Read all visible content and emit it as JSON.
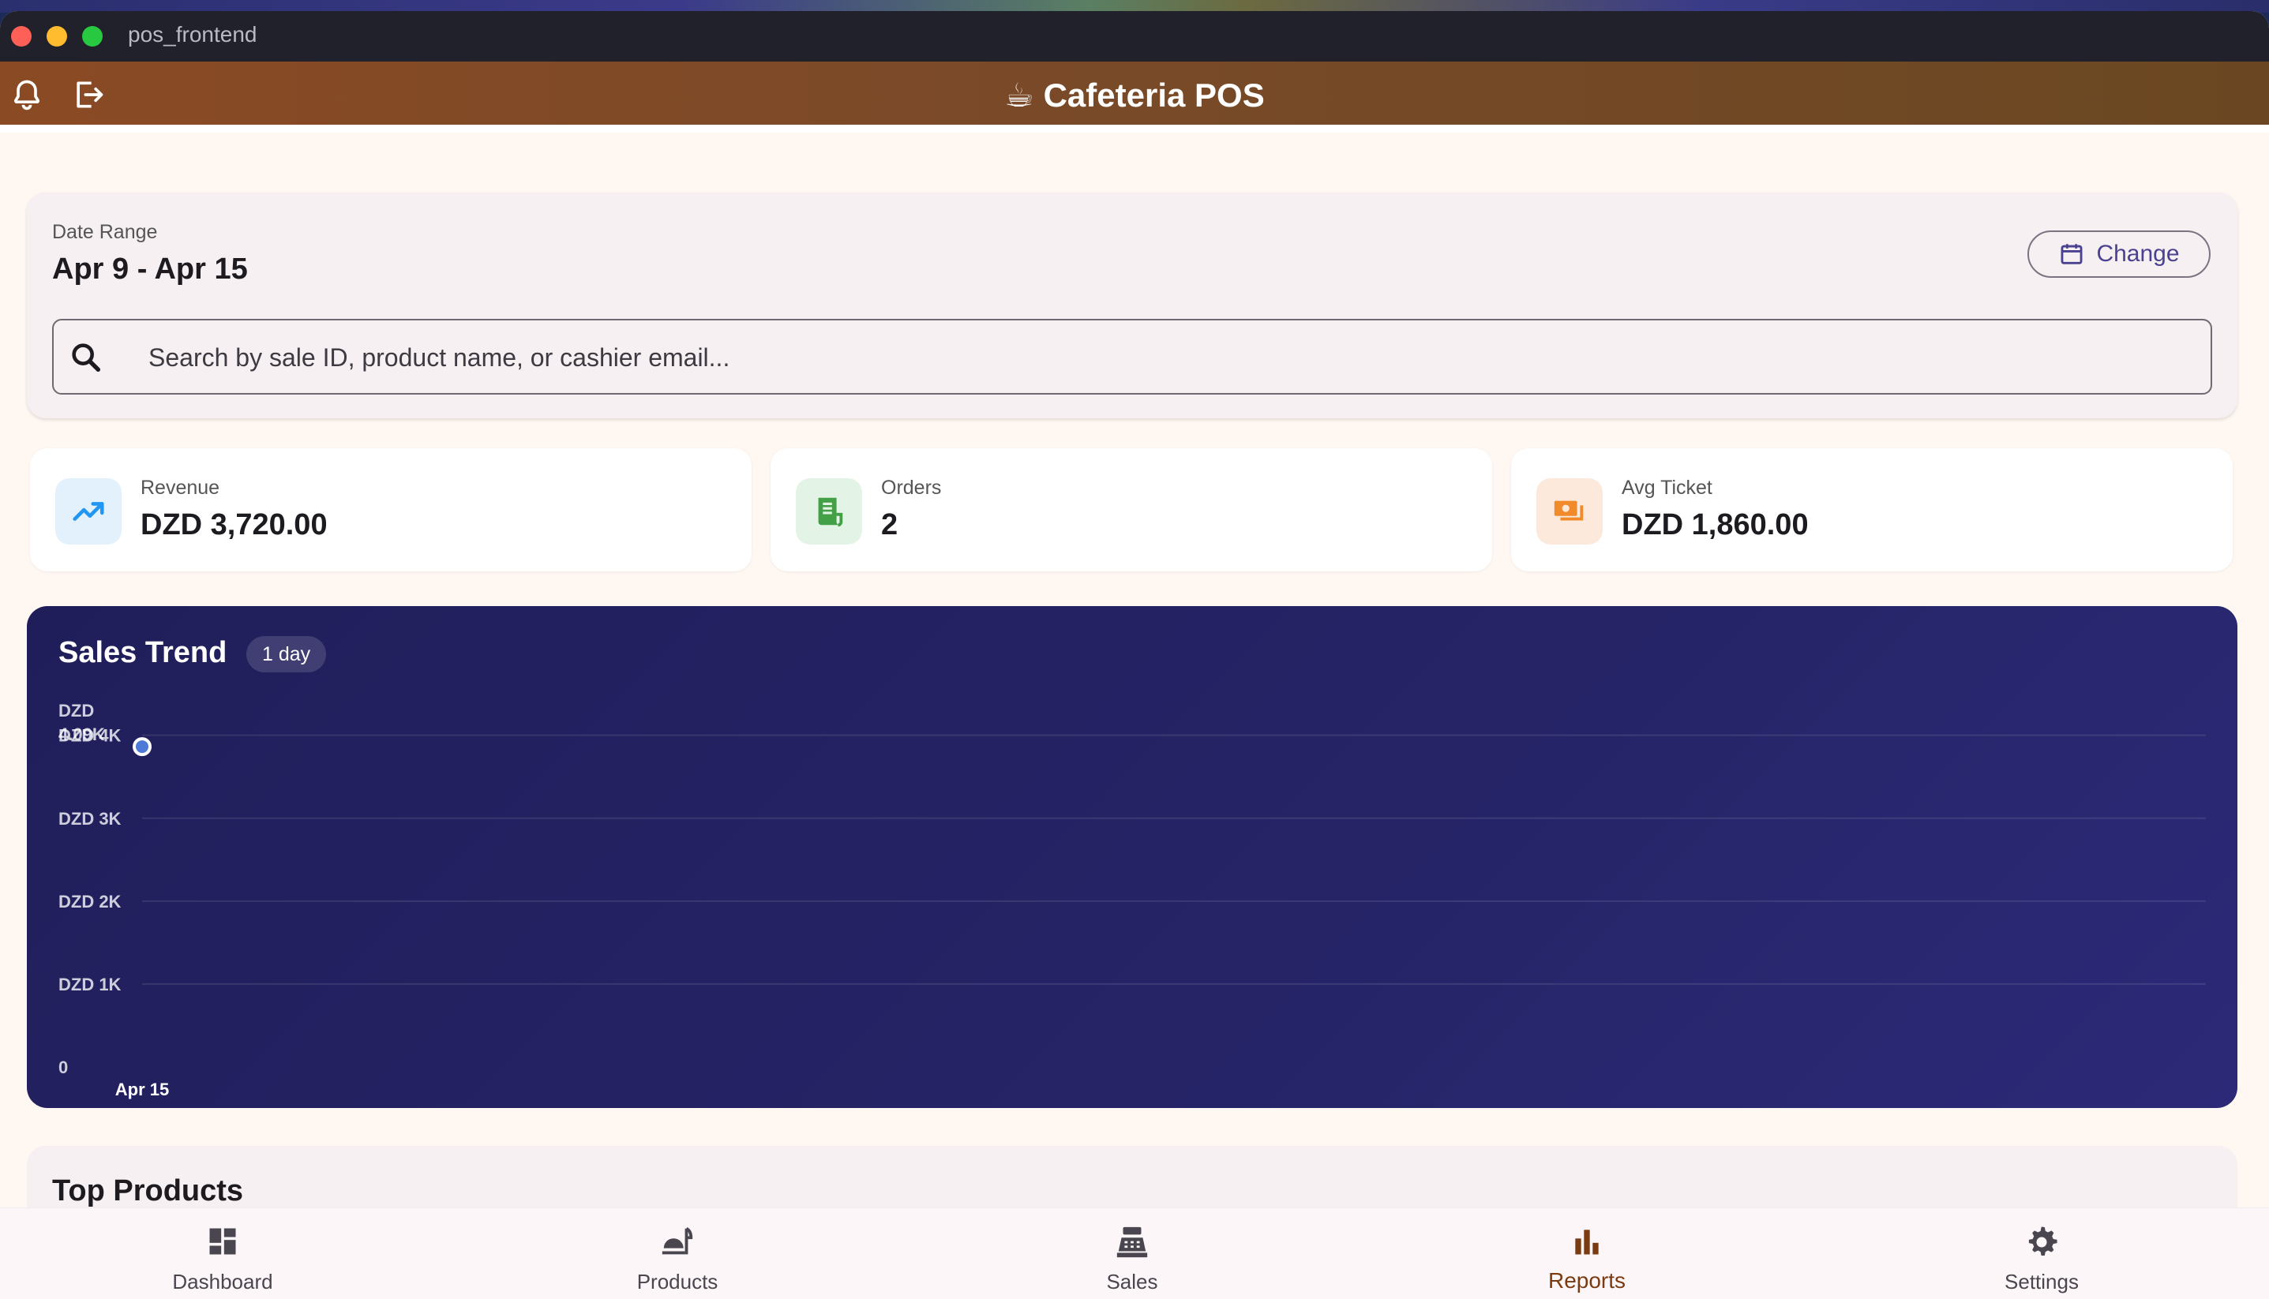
{
  "window": {
    "title": "pos_frontend"
  },
  "appbar": {
    "title": "☕ Cafeteria POS",
    "notifications_icon": "bell-icon",
    "logout_icon": "logout-icon"
  },
  "date_range": {
    "label": "Date Range",
    "value": "Apr 9 - Apr 15",
    "change_label": "Change"
  },
  "search": {
    "placeholder": "Search by sale ID, product name, or cashier email..."
  },
  "stats": [
    {
      "label": "Revenue",
      "value": "DZD 3,720.00",
      "icon": "trending-up-icon",
      "color": "#2196f3"
    },
    {
      "label": "Orders",
      "value": "2",
      "icon": "receipt-icon",
      "color": "#43a047"
    },
    {
      "label": "Avg Ticket",
      "value": "DZD 1,860.00",
      "icon": "payments-icon",
      "color": "#f08a2a"
    }
  ],
  "chart": {
    "title": "Sales Trend",
    "badge": "1 day"
  },
  "chart_data": {
    "type": "line",
    "x": [
      "Apr 15"
    ],
    "series": [
      {
        "values": [
          3720
        ]
      }
    ],
    "yticks": [
      "0",
      "DZD 1K",
      "DZD 2K",
      "DZD 3K",
      "DZD 4K",
      "DZD 4.09K"
    ],
    "ytick_values": [
      0,
      1000,
      2000,
      3000,
      4000,
      4092
    ],
    "ylim": [
      0,
      4092
    ],
    "grid": true
  },
  "top_products": {
    "title": "Top Products"
  },
  "nav": [
    {
      "label": "Dashboard",
      "icon": "dashboard-icon",
      "active": false
    },
    {
      "label": "Products",
      "icon": "food-icon",
      "active": false
    },
    {
      "label": "Sales",
      "icon": "cash-register-icon",
      "active": false
    },
    {
      "label": "Reports",
      "icon": "bar-chart-icon",
      "active": true
    },
    {
      "label": "Settings",
      "icon": "gear-icon",
      "active": false
    }
  ]
}
